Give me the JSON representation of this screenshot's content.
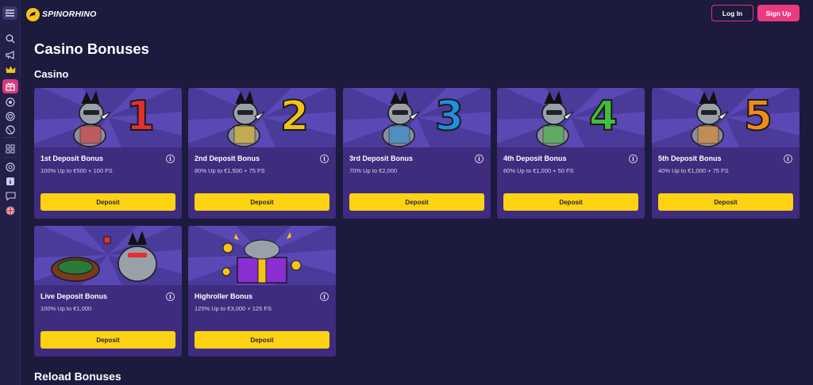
{
  "header": {
    "logo_text": "SPINORHINO",
    "login_label": "Log In",
    "signup_label": "Sign Up"
  },
  "sidebar": {
    "icons": [
      "menu-toggle-icon",
      "search-icon",
      "megaphone-icon",
      "crown-icon",
      "gift-icon",
      "shield-icon",
      "target-icon",
      "sports-ball-icon",
      "grid-icon",
      "support-icon",
      "info-icon",
      "chat-icon",
      "uk-flag-icon"
    ]
  },
  "page": {
    "title": "Casino Bonuses",
    "section": "Casino",
    "next_section": "Reload Bonuses"
  },
  "colors": {
    "background": "#1c1a3d",
    "card": "#3f2c7e",
    "art": "#4a3a9a",
    "accent_pink": "#ec3a82",
    "deposit_yellow": "#fdd212"
  },
  "bonuses": [
    {
      "title": "1st Deposit Bonus",
      "desc": "100% Up to €500 + 100 FS",
      "numeral": "1",
      "numeral_color": "#e5302e",
      "button": "Deposit"
    },
    {
      "title": "2nd Deposit Bonus",
      "desc": "80% Up to €1,500 + 75 FS",
      "numeral": "2",
      "numeral_color": "#f2c21a",
      "button": "Deposit"
    },
    {
      "title": "3rd Deposit Bonus",
      "desc": "70% Up to €2,000",
      "numeral": "3",
      "numeral_color": "#1f8fe0",
      "button": "Deposit"
    },
    {
      "title": "4th Deposit Bonus",
      "desc": "60% Up to €1,000 + 50 FS",
      "numeral": "4",
      "numeral_color": "#3fbf3a",
      "button": "Deposit"
    },
    {
      "title": "5th Deposit Bonus",
      "desc": "40% Up to €1,000 + 75 FS",
      "numeral": "5",
      "numeral_color": "#f08a1c",
      "button": "Deposit"
    },
    {
      "title": "Live Deposit Bonus",
      "desc": "100% Up to €1,000",
      "numeral": "",
      "numeral_color": "",
      "button": "Deposit"
    },
    {
      "title": "Highroller Bonus",
      "desc": "125% Up to €3,000 + 125 FS",
      "numeral": "",
      "numeral_color": "",
      "button": "Deposit"
    }
  ]
}
